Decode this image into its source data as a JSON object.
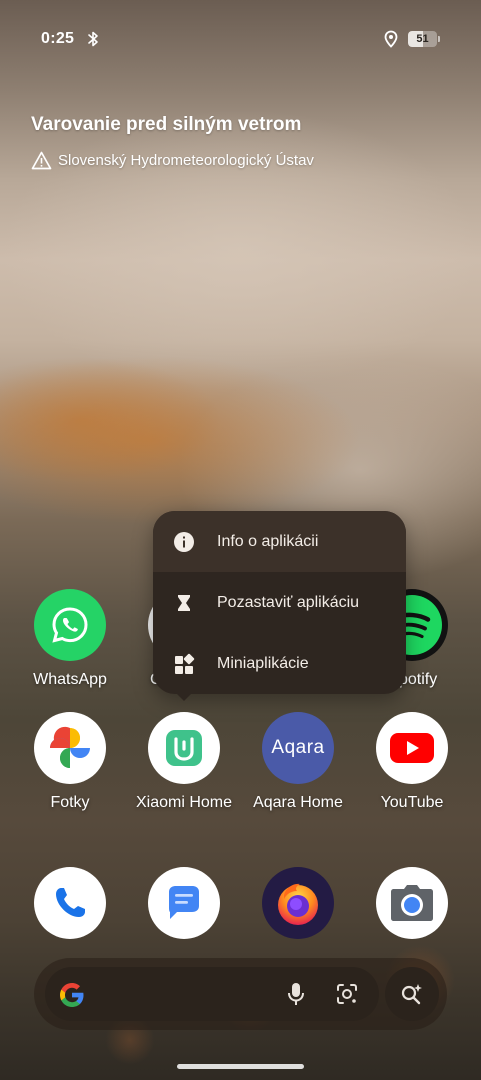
{
  "status_bar": {
    "time": "0:25",
    "battery_level": "51",
    "battery_fraction": 0.51,
    "icons": [
      "bluetooth-icon",
      "location-icon",
      "battery-icon"
    ]
  },
  "alert_widget": {
    "title": "Varovanie pred silným vetrom",
    "source": "Slovenský Hydrometeorologický Ústav",
    "icon": "warning-triangle-icon"
  },
  "context_menu": {
    "items": [
      {
        "label": "Info o aplikácii",
        "icon": "info-icon"
      },
      {
        "label": "Pozastaviť aplikáciu",
        "icon": "hourglass-icon"
      },
      {
        "label": "Miniaplikácie",
        "icon": "widgets-icon"
      }
    ]
  },
  "apps_row1": [
    {
      "label": "WhatsApp",
      "icon": "whatsapp-icon"
    },
    {
      "label": "C",
      "icon": "app-icon"
    },
    {
      "label": "potify",
      "icon": "spotify-icon"
    }
  ],
  "apps_row2": [
    {
      "label": "Fotky",
      "icon": "google-photos-icon"
    },
    {
      "label": "Xiaomi Home",
      "icon": "xiaomi-home-icon"
    },
    {
      "label": "Aqara Home",
      "icon": "aqara-icon",
      "icon_text": "Aqara"
    },
    {
      "label": "YouTube",
      "icon": "youtube-icon"
    }
  ],
  "dock": [
    {
      "icon": "phone-icon"
    },
    {
      "icon": "messages-icon"
    },
    {
      "icon": "firefox-icon"
    },
    {
      "icon": "camera-icon"
    }
  ],
  "search_bar": {
    "icons": [
      "google-logo-icon",
      "microphone-icon",
      "google-lens-icon",
      "ai-search-icon"
    ]
  },
  "colors": {
    "menu_bg": "#2e2620",
    "menu_highlight": "#3c3129",
    "whatsapp": "#25d366",
    "spotify": "#1ed760",
    "youtube": "#ff0000",
    "aqara": "#4a5aa8",
    "xiaomi_home": "#3fc28b"
  }
}
